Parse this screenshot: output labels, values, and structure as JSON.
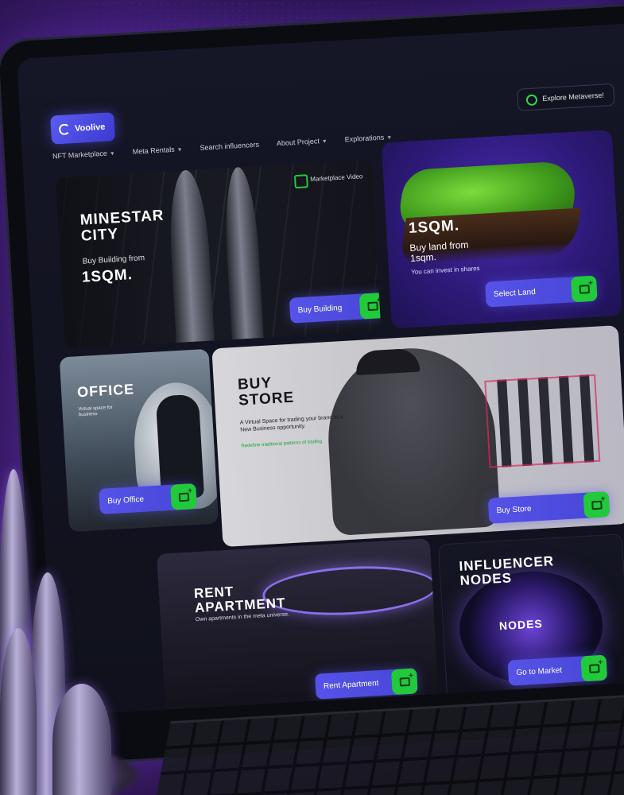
{
  "header": {
    "brand": "Voolive",
    "explore_button": "Explore Metaverse!",
    "nav": [
      {
        "label": "NFT Marketplace",
        "has_dropdown": true
      },
      {
        "label": "Meta Rentals",
        "has_dropdown": true
      },
      {
        "label": "Search influencers",
        "has_dropdown": false
      },
      {
        "label": "About Project",
        "has_dropdown": true
      },
      {
        "label": "Explorations",
        "has_dropdown": true
      }
    ]
  },
  "cards": {
    "city": {
      "title_line1": "MINESTAR",
      "title_line2": "CITY",
      "subtitle": "Buy Building from",
      "highlight": "1SQM.",
      "video_label": "Marketplace Video",
      "cta": "Buy Building"
    },
    "land": {
      "highlight": "1SQM.",
      "subtitle_line1": "Buy land from",
      "subtitle_line2": "1sqm.",
      "note": "You can invest in shares",
      "cta": "Select Land"
    },
    "office": {
      "title": "OFFICE",
      "description": "Virtual space for business",
      "cta": "Buy Office"
    },
    "store": {
      "title_line1": "BUY",
      "title_line2": "STORE",
      "description": "A Virtual Space for trading your brand in a New Business opportunity.",
      "note": "Redefine traditional patterns of trading",
      "cta": "Buy Store"
    },
    "apartment": {
      "title_line1": "RENT",
      "title_line2": "APARTMENT",
      "description": "Own apartments in the meta universe.",
      "cta": "Rent Apartment"
    },
    "influencer": {
      "title_line1": "INFLUENCER",
      "title_line2": "NODES",
      "badge": "NODES",
      "cta": "Go to Market"
    }
  },
  "colors": {
    "accent": "#5653e8",
    "go_button": "#22c93b",
    "background": "#120a28"
  },
  "icons": {
    "cta_go": "add-to-cart-icon",
    "explore": "globe-icon",
    "video": "video-icon"
  }
}
